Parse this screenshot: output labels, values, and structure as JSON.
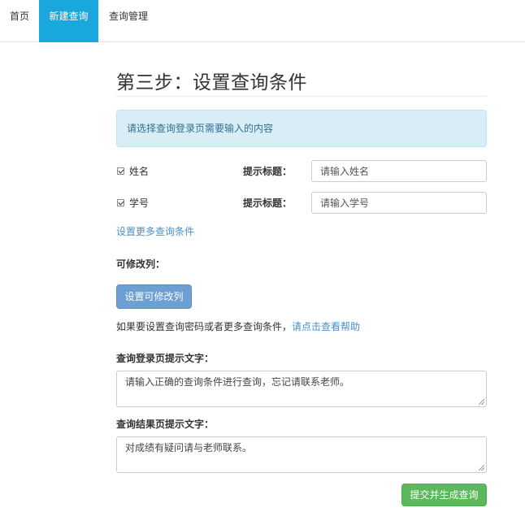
{
  "nav": {
    "items": [
      {
        "label": "首页"
      },
      {
        "label": "新建查询"
      },
      {
        "label": "查询管理"
      }
    ],
    "active_color": "#18a8db"
  },
  "main": {
    "title": "第三步：设置查询条件",
    "alert": "请选择查询登录页需要输入的内容",
    "conditions": [
      {
        "name": "姓名",
        "checked": true,
        "hint_label": "提示标题：",
        "placeholder": "请输入姓名"
      },
      {
        "name": "学号",
        "checked": true,
        "hint_label": "提示标题：",
        "placeholder": "请输入学号"
      }
    ],
    "more_link": "设置更多查询条件",
    "editable_label": "可修改列：",
    "editable_button": "设置可修改列",
    "help_text": "如果要设置查询密码或者更多查询条件，",
    "help_link": "请点击查看帮助",
    "login_hint_label": "查询登录页提示文字：",
    "login_hint_value": "请输入正确的查询条件进行查询，忘记请联系老师。",
    "result_hint_label": "查询结果页提示文字：",
    "result_hint_value": "对成绩有疑问请与老师联系。",
    "submit_button": "提交并生成查询"
  }
}
